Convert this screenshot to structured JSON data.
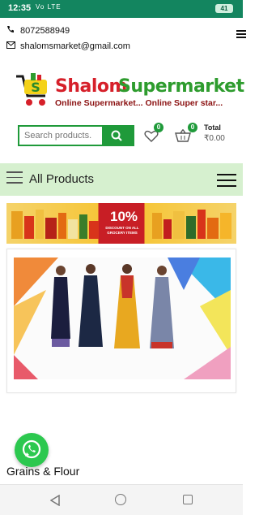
{
  "status_bar": {
    "time": "12:35",
    "signal": "Vo LTE",
    "battery": "41"
  },
  "contact": {
    "phone": "8072588949",
    "email": "shalomsmarket@gmail.com"
  },
  "brand": {
    "name_part1": "Shalom",
    "name_part2": "Supermarket",
    "tagline": "Online Supermarket... Online Super star..."
  },
  "search": {
    "placeholder": "Search products."
  },
  "wishlist": {
    "count": "0"
  },
  "cart": {
    "count": "0",
    "total_label": "Total",
    "total_value": "₹0.00"
  },
  "nav": {
    "all_products": "All Products"
  },
  "promo": {
    "discount": "10%",
    "subtext": "DISCOUNT ON ALL GROCERY ITEMS"
  },
  "section": {
    "label": "Grains & Flour"
  },
  "colors": {
    "status_bar": "#13855f",
    "accent_green": "#1f9a3a",
    "brand_red": "#d6202a",
    "category_bar": "#d6f0cf"
  }
}
